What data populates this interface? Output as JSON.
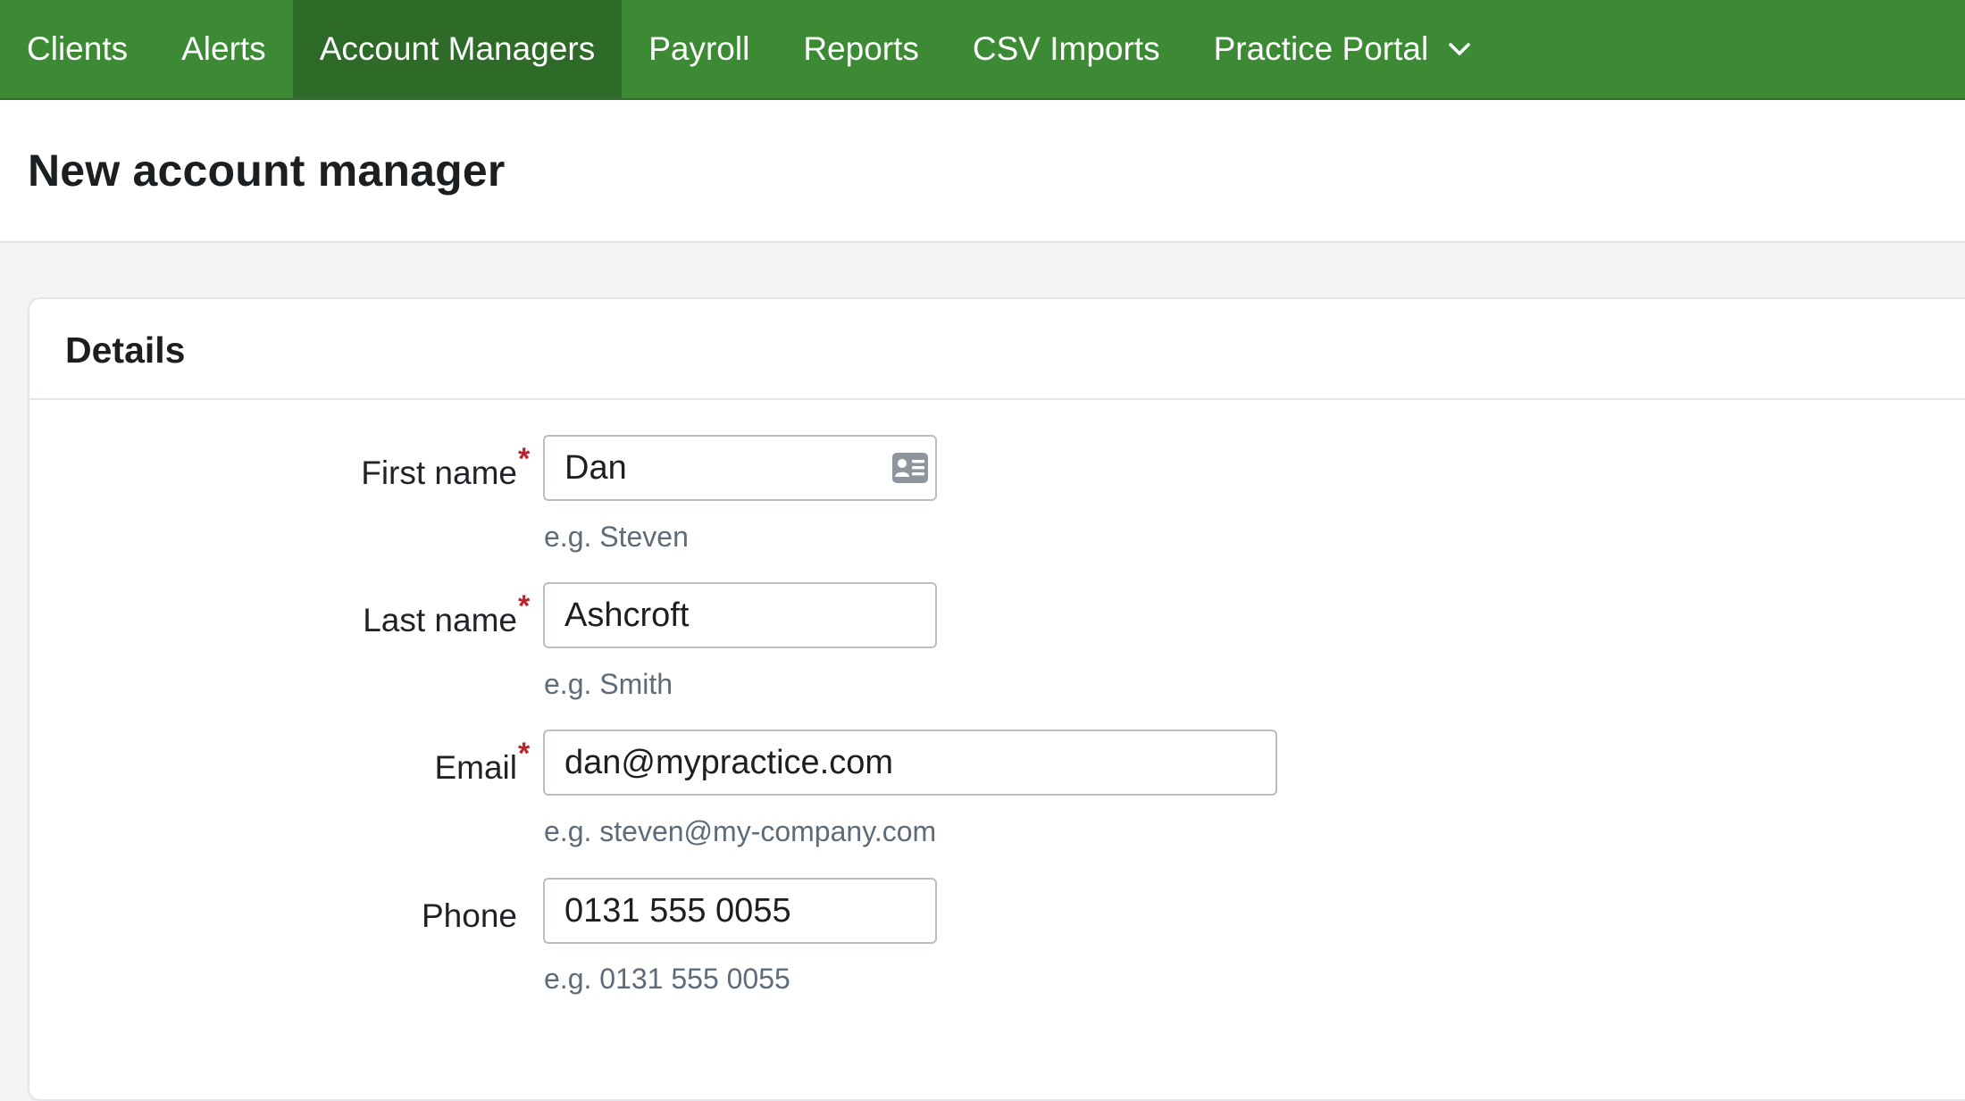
{
  "nav": {
    "items": [
      {
        "label": "Clients",
        "active": false
      },
      {
        "label": "Alerts",
        "active": false
      },
      {
        "label": "Account Managers",
        "active": true
      },
      {
        "label": "Payroll",
        "active": false
      },
      {
        "label": "Reports",
        "active": false
      },
      {
        "label": "CSV Imports",
        "active": false
      },
      {
        "label": "Practice Portal",
        "active": false,
        "dropdown": true
      }
    ],
    "dropdown_icon": "chevron-down-icon"
  },
  "page": {
    "title": "New account manager"
  },
  "card": {
    "title": "Details"
  },
  "form": {
    "first_name": {
      "label": "First name",
      "required": true,
      "required_marker": "*",
      "value": "Dan",
      "hint": "e.g. Steven",
      "icon": "contact-card-icon"
    },
    "last_name": {
      "label": "Last name",
      "required": true,
      "required_marker": "*",
      "value": "Ashcroft",
      "hint": "e.g. Smith"
    },
    "email": {
      "label": "Email",
      "required": true,
      "required_marker": "*",
      "value": "dan@mypractice.com",
      "hint": "e.g. steven@my-company.com"
    },
    "phone": {
      "label": "Phone",
      "required": false,
      "value": "0131 555 0055",
      "hint": "e.g. 0131 555 0055"
    }
  },
  "colors": {
    "nav_background": "#3d8a35",
    "nav_active": "#2e6a28",
    "required_marker": "#c0202a",
    "hint_text": "#5e6b78"
  }
}
